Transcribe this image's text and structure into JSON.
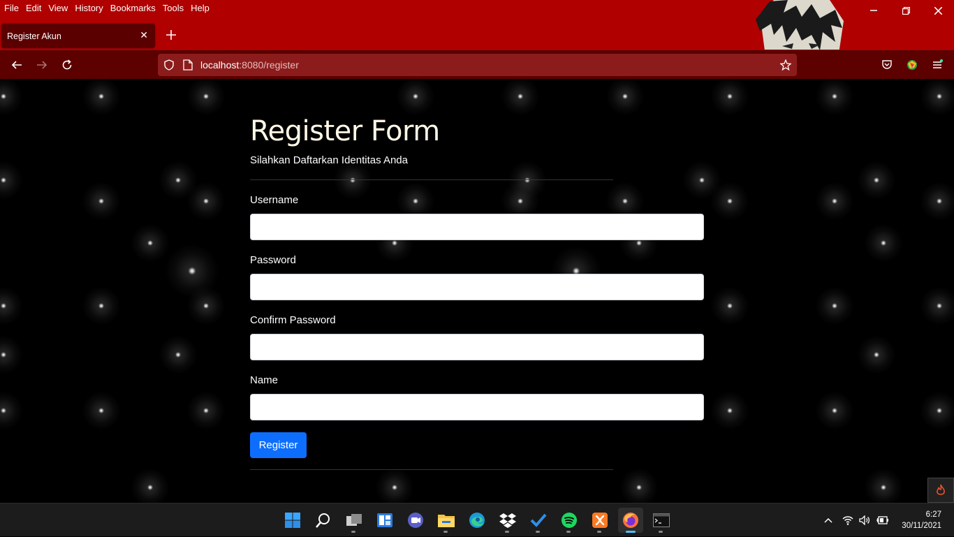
{
  "browser": {
    "menu": [
      "File",
      "Edit",
      "View",
      "History",
      "Bookmarks",
      "Tools",
      "Help"
    ],
    "tab_title": "Register Akun",
    "url_host": "localhost",
    "url_rest": ":8080/register"
  },
  "form": {
    "title": "Register Form",
    "subtitle": "Silahkan Daftarkan Identitas Anda",
    "fields": [
      {
        "label": "Username",
        "value": ""
      },
      {
        "label": "Password",
        "value": ""
      },
      {
        "label": "Confirm Password",
        "value": ""
      },
      {
        "label": "Name",
        "value": ""
      }
    ],
    "submit_label": "Register"
  },
  "taskbar": {
    "time": "6:27",
    "date": "30/11/2021"
  },
  "colors": {
    "chrome_red": "#b00000",
    "button_blue": "#0d6efd"
  }
}
